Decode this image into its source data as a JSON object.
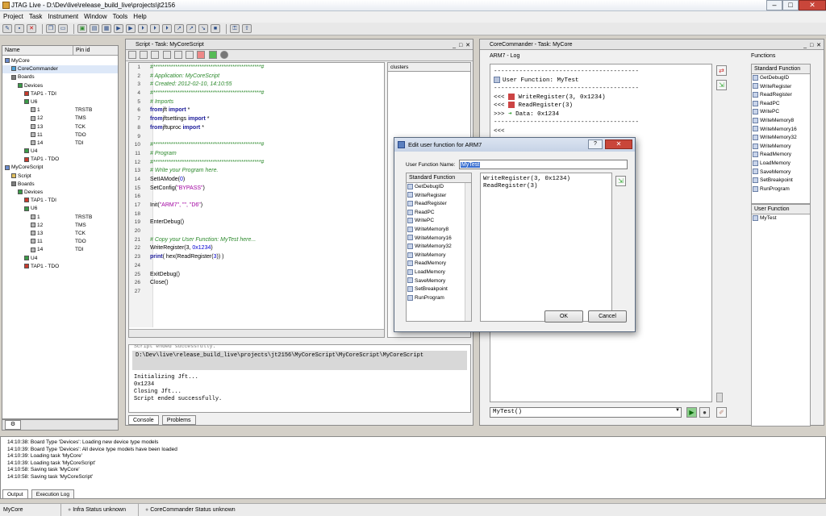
{
  "app": {
    "title": "JTAG Live - D:\\Dev\\live\\release_build_live\\projects\\jt2156"
  },
  "menu": [
    "Project",
    "Task",
    "Instrument",
    "Window",
    "Tools",
    "Help"
  ],
  "left": {
    "col_name": "Name",
    "col_pin": "Pin id",
    "tree": [
      {
        "t": "MyCore",
        "d": 0,
        "ic": "#6b8ccf",
        "pin": ""
      },
      {
        "t": "CoreCommander",
        "d": 1,
        "ic": "#4ca3d9",
        "pin": "",
        "sel": true
      },
      {
        "t": "Boards",
        "d": 1,
        "ic": "#7d7d7d",
        "pin": ""
      },
      {
        "t": "Devices",
        "d": 2,
        "ic": "#3b9b48",
        "pin": ""
      },
      {
        "t": "TAP1 - TDI",
        "d": 3,
        "ic": "#c83a2c",
        "pin": ""
      },
      {
        "t": "U6",
        "d": 3,
        "ic": "#3b9b48",
        "pin": ""
      },
      {
        "t": "1",
        "d": 4,
        "ic": "#b8b8b8",
        "pin": "TRSTB"
      },
      {
        "t": "12",
        "d": 4,
        "ic": "#b8b8b8",
        "pin": "TMS"
      },
      {
        "t": "13",
        "d": 4,
        "ic": "#b8b8b8",
        "pin": "TCK"
      },
      {
        "t": "11",
        "d": 4,
        "ic": "#b8b8b8",
        "pin": "TDO"
      },
      {
        "t": "14",
        "d": 4,
        "ic": "#b8b8b8",
        "pin": "TDI"
      },
      {
        "t": "U4",
        "d": 3,
        "ic": "#3b9b48",
        "pin": ""
      },
      {
        "t": "TAP1 - TDO",
        "d": 3,
        "ic": "#c83a2c",
        "pin": ""
      },
      {
        "t": "MyCoreScript",
        "d": 0,
        "ic": "#6b8ccf",
        "pin": ""
      },
      {
        "t": "Script",
        "d": 1,
        "ic": "#e0c060",
        "pin": ""
      },
      {
        "t": "Boards",
        "d": 1,
        "ic": "#7d7d7d",
        "pin": ""
      },
      {
        "t": "Devices",
        "d": 2,
        "ic": "#3b9b48",
        "pin": ""
      },
      {
        "t": "TAP1 - TDI",
        "d": 3,
        "ic": "#c83a2c",
        "pin": ""
      },
      {
        "t": "U6",
        "d": 3,
        "ic": "#3b9b48",
        "pin": ""
      },
      {
        "t": "1",
        "d": 4,
        "ic": "#b8b8b8",
        "pin": "TRSTB"
      },
      {
        "t": "12",
        "d": 4,
        "ic": "#b8b8b8",
        "pin": "TMS"
      },
      {
        "t": "13",
        "d": 4,
        "ic": "#b8b8b8",
        "pin": "TCK"
      },
      {
        "t": "11",
        "d": 4,
        "ic": "#b8b8b8",
        "pin": "TDO"
      },
      {
        "t": "14",
        "d": 4,
        "ic": "#b8b8b8",
        "pin": "TDI"
      },
      {
        "t": "U4",
        "d": 3,
        "ic": "#3b9b48",
        "pin": ""
      },
      {
        "t": "TAP1 - TDO",
        "d": 3,
        "ic": "#c83a2c",
        "pin": ""
      }
    ]
  },
  "script": {
    "title": "Script - Task: MyCoreScript",
    "clusters_tab": "clusters",
    "lines": [
      [
        [
          "cm",
          "#*************************************************#"
        ]
      ],
      [
        [
          "cm",
          "# Application: MyCoreScript"
        ]
      ],
      [
        [
          "cm",
          "# Created: 2012-02-10, 14:10:55"
        ]
      ],
      [
        [
          "cm",
          "#*************************************************#"
        ]
      ],
      [
        [
          "cm",
          "# Imports"
        ]
      ],
      [
        [
          "kw",
          "from"
        ],
        [
          "",
          "jft "
        ],
        [
          "kw",
          "import"
        ],
        [
          "",
          " *"
        ]
      ],
      [
        [
          "kw",
          "from"
        ],
        [
          "",
          "jftsettings "
        ],
        [
          "kw",
          "import"
        ],
        [
          "",
          " *"
        ]
      ],
      [
        [
          "kw",
          "from"
        ],
        [
          "",
          "jftuproc "
        ],
        [
          "kw",
          "import"
        ],
        [
          "",
          " *"
        ]
      ],
      [
        [
          "",
          ""
        ]
      ],
      [
        [
          "cm",
          "#*************************************************#"
        ]
      ],
      [
        [
          "cm",
          "# Program"
        ]
      ],
      [
        [
          "cm",
          "#*************************************************#"
        ]
      ],
      [
        [
          "cm",
          "# Write your Program here."
        ]
      ],
      [
        [
          "",
          "SetIAMode("
        ],
        [
          "nm",
          "0"
        ],
        [
          "",
          ")"
        ]
      ],
      [
        [
          "",
          "SetConfig("
        ],
        [
          "st",
          "\"BYPASS\""
        ],
        [
          "",
          ")"
        ]
      ],
      [
        [
          "",
          ""
        ]
      ],
      [
        [
          "",
          "Init("
        ],
        [
          "st",
          "\"ARM7\", \"\", \"D6\""
        ],
        [
          "",
          ")"
        ]
      ],
      [
        [
          "",
          ""
        ]
      ],
      [
        [
          "",
          "EnterDebug()"
        ]
      ],
      [
        [
          "",
          ""
        ]
      ],
      [
        [
          "cm",
          "# Copy your User Function: MyTest here..."
        ]
      ],
      [
        [
          "",
          "WriteRegister(3, "
        ],
        [
          "nm",
          "0x1234"
        ],
        [
          "",
          ")"
        ]
      ],
      [
        [
          "kw",
          "print"
        ],
        [
          "",
          "( hex(ReadRegister("
        ],
        [
          "nm",
          "3"
        ],
        [
          "",
          ")) )"
        ]
      ],
      [
        [
          "",
          ""
        ]
      ],
      [
        [
          "",
          "ExitDebug()"
        ]
      ],
      [
        [
          "",
          "Close()"
        ]
      ],
      [
        [
          "",
          ""
        ]
      ]
    ],
    "console_partial": "Script ended successfully.",
    "console_path": "D:\\Dev\\live\\release_build_live\\projects\\jt2156\\MyCoreScript\\MyCoreScript\\MyCoreScript",
    "console_lines": [
      "Initializing Jft...",
      "0x1234",
      "Closing Jft...",
      "Script ended successfully."
    ],
    "tab_console": "Console",
    "tab_problems": "Problems"
  },
  "cc": {
    "title": "CoreCommander - Task: MyCore",
    "log_label": "ARM7 - Log",
    "functions_label": "Functions",
    "log": {
      "dash": "----------------------------------------",
      "uf": "User Function: MyTest",
      "l1a": "<<<",
      "l1b": "WriteRegister(3, 0x1234)",
      "l2a": "<<<",
      "l2b": "ReadRegister(3)",
      "l3a": ">>>",
      "l3b": "Data: 0x1234",
      "l4a": "<<<"
    },
    "input_value": "MyTest()",
    "std_header": "Standard Function",
    "std_funcs": [
      "GetDebugID",
      "WriteRegister",
      "ReadRegister",
      "ReadPC",
      "WritePC",
      "WriteMemory8",
      "WriteMemory16",
      "WriteMemory32",
      "WriteMemory",
      "ReadMemory",
      "LoadMemory",
      "SaveMemory",
      "SetBreakpoint",
      "RunProgram"
    ],
    "user_header": "User Function",
    "user_funcs": [
      "MyTest"
    ]
  },
  "dialog": {
    "title": "Edit user function for ARM7",
    "name_label": "User Function Name:",
    "name_value": "MyTest",
    "std_header": "Standard Function",
    "std_funcs": [
      "GetDebugID",
      "WriteRegister",
      "ReadRegister",
      "ReadPC",
      "WritePC",
      "WriteMemory8",
      "WriteMemory16",
      "WriteMemory32",
      "WriteMemory",
      "ReadMemory",
      "LoadMemory",
      "SaveMemory",
      "SetBreakpoint",
      "RunProgram"
    ],
    "code": "WriteRegister(3, 0x1234)\nReadRegister(3)",
    "ok": "OK",
    "cancel": "Cancel"
  },
  "output": {
    "lines": [
      "14:10:38: Board Type 'Devices': Loading new device type models",
      "14:10:39: Board Type 'Devices': All device type models have been loaded",
      "14:10:39: Loading task 'MyCore'",
      "14:10:39: Loading task 'MyCoreScript'",
      "14:10:58: Saving task 'MyCore'",
      "14:10:58: Saving task 'MyCoreScript'"
    ],
    "tab_output": "Output",
    "tab_exec": "Execution Log"
  },
  "status": {
    "project": "MyCore",
    "infra": "Infra",
    "infra_status": "Status unknown",
    "cc": "CoreCommander",
    "cc_status": "Status unknown"
  }
}
